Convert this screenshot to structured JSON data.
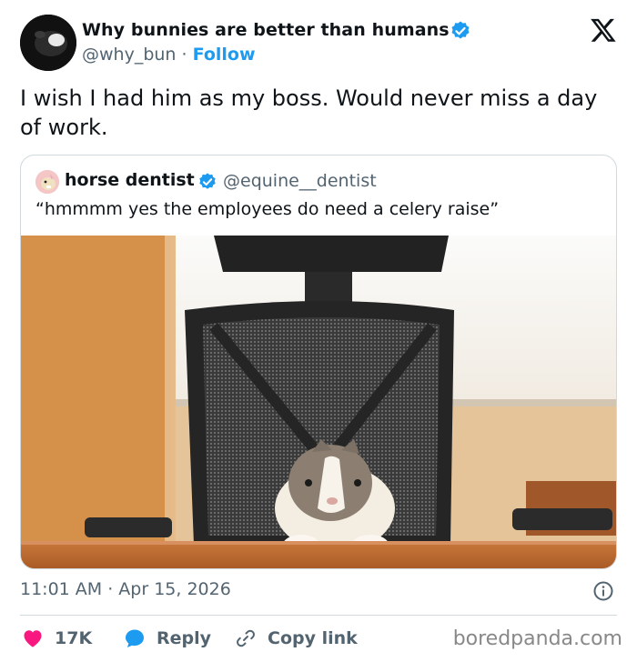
{
  "author": {
    "display_name": "Why bunnies are better than humans",
    "handle": "@why_bun",
    "separator": "·",
    "follow_label": "Follow",
    "verified": true
  },
  "tweet": {
    "text": "I wish I had him as my boss. Would never miss a day of work."
  },
  "quoted_tweet": {
    "display_name": "horse dentist",
    "handle": "@equine__dentist",
    "verified": true,
    "text": "“hmmmm yes the employees do need a celery raise”"
  },
  "meta": {
    "timestamp": "11:01 AM · Apr 15, 2026"
  },
  "actions": {
    "like_count": "17K",
    "reply_label": "Reply",
    "copy_link_label": "Copy link"
  },
  "watermark": "boredpanda.com",
  "colors": {
    "accent": "#1d9bf0",
    "like": "#f91880",
    "text": "#0f1419",
    "muted": "#536471",
    "border": "#cfd9de"
  },
  "icons": {
    "platform": "x-logo-icon",
    "verified": "verified-badge-icon",
    "info": "info-icon",
    "like": "heart-icon",
    "reply": "reply-bubble-icon",
    "copy": "link-icon"
  }
}
